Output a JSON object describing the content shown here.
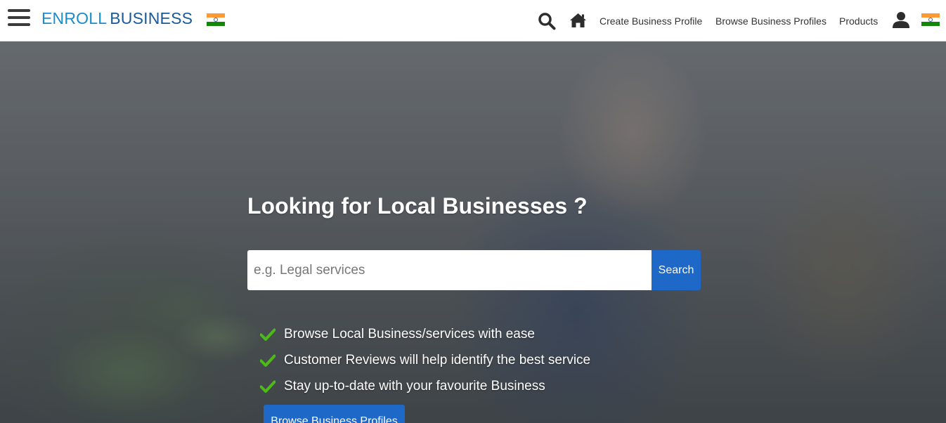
{
  "header": {
    "brand_part1": "ENROLL",
    "brand_part2": "BUSINESS",
    "icons": [
      "hamburger-menu-icon",
      "india-flag-icon",
      "search-icon",
      "home-icon",
      "user-icon",
      "india-flag-icon"
    ],
    "nav_links": [
      "Create Business Profile",
      "Browse Business Profiles",
      "Products"
    ]
  },
  "hero": {
    "headline": "Looking for Local Businesses ?",
    "search": {
      "placeholder": "e.g. Legal services",
      "value": "",
      "button_label": "Search"
    },
    "features": [
      "Browse Local Business/services with ease",
      "Customer Reviews will help identify the best service",
      "Stay up-to-date with your favourite Business"
    ],
    "feature_icon": "check-icon",
    "cta_label": "Browse Business Profiles"
  },
  "colors": {
    "brand_light": "#1b8ccc",
    "brand_dark": "#1a5a9a",
    "primary_button": "#1e68c8",
    "check": "#4cbb17"
  }
}
